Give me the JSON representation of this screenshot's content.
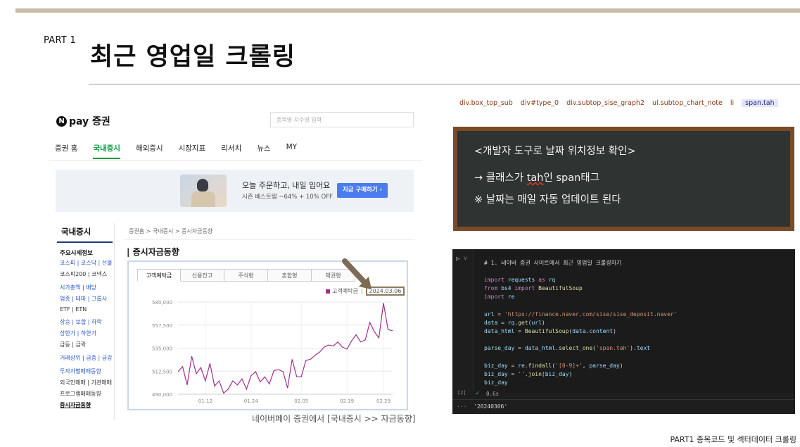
{
  "slide": {
    "part_label": "PART 1",
    "title": "최근 영업일 크롤링",
    "caption": "네이버페이 증권에서 [국내증시 >> 자금동향]",
    "footer": "PART1 종목코드 및 섹터데이터 크롤링"
  },
  "naver": {
    "logo_text": "pay 증권",
    "logo_mark": "N",
    "search_placeholder": "종목명·지수명 입력",
    "gnb": [
      "증권 홈",
      "국내증시",
      "해외증시",
      "시장지표",
      "리서치",
      "뉴스",
      "MY"
    ],
    "gnb_active": "국내증시",
    "banner": {
      "title": "오늘 주문하고, 내일 입어요",
      "sub": "시즌 베스트템 ~64% + 10% OFF",
      "button": "지금 구매하기 ›"
    },
    "sidebar": {
      "title": "국내증시",
      "groups": [
        {
          "head": "주요시세정보",
          "rows": [
            "코스피 | 코스닥 | 선물",
            "코스피200 | 코넥스"
          ],
          "row_style": [
            "blue",
            "plain"
          ]
        },
        {
          "head": "",
          "rows": [
            "시가총액 | 배당",
            "업종 | 테마 | 그룹사",
            "ETF | ETN"
          ],
          "row_style": [
            "blue",
            "blue",
            "plain"
          ]
        },
        {
          "head": "",
          "rows": [
            "상승 | 보합 | 하락",
            "상한가 | 하한가",
            "급등 | 급락"
          ],
          "row_style": [
            "blue",
            "blue",
            "plain"
          ]
        },
        {
          "head": "",
          "rows": [
            "거래상위 | 급증 | 급감"
          ],
          "row_style": [
            "blue"
          ]
        },
        {
          "head": "",
          "rows": [
            "투자자별매매동향",
            "외국인매매 | 기관매매",
            "프로그램매매동향",
            "증시자금동향"
          ],
          "row_style": [
            "blue",
            "plain",
            "plain",
            "sel"
          ]
        }
      ]
    },
    "breadcrumb": "증권홈 > 국내증시 > 증시자금동향",
    "section_title": "증시자금동향",
    "tabs": [
      "고객예탁금",
      "신용잔고",
      "주식형",
      "혼합형",
      "채권형"
    ],
    "tab_active": "고객예탁금",
    "legend_label": "고객예탁금",
    "legend_date": "2024.03.06"
  },
  "chart_data": {
    "type": "line",
    "title": "",
    "xlabel": "",
    "ylabel": "",
    "y_ticks": [
      "580,000",
      "557,500",
      "535,000",
      "512,500",
      "490,000"
    ],
    "x_ticks": [
      "01.12",
      "01.24",
      "02.05",
      "02.19",
      "02.29"
    ],
    "ylim": [
      490000,
      580000
    ],
    "series": [
      {
        "name": "고객예탁금",
        "color": "#a0308a",
        "values": [
          512000,
          517000,
          499000,
          527000,
          510000,
          516000,
          503000,
          520000,
          498000,
          503000,
          491000,
          495000,
          503000,
          499000,
          505000,
          495000,
          508000,
          512000,
          502000,
          507000,
          500000,
          513000,
          514000,
          512000,
          496000,
          524000,
          507000,
          507000,
          523000,
          524000,
          528000,
          531000,
          536000,
          538000,
          537000,
          541000,
          536000,
          534000,
          542000,
          548000,
          541000,
          543000,
          560000,
          551000,
          545000,
          579000,
          553000,
          552000
        ]
      }
    ]
  },
  "devtools_path": [
    "div.box_top_sub",
    "div#type_0",
    "div.subtop_sise_graph2",
    "ul.subtop_chart_note",
    "li",
    "span.tah"
  ],
  "board": {
    "line1": "<개발자 도구로 날짜 위치정보 확인>",
    "line2_pre": "→ 클래스가 ",
    "line2_under": "tah",
    "line2_post": "인 span태그",
    "line3": "※ 날짜는 매일 자동 업데이트 된다"
  },
  "code": {
    "comment": "# 1. 네이버 증권 사이트에서 최근 영업일 크롤링하기",
    "import1": "import requests as rq",
    "import2": "from bs4 import BeautifulSoup",
    "import3": "import re",
    "url_line": "url = 'https://finance.naver.com/sise/sise_deposit.naver'",
    "data_line": "data = rq.get(url)",
    "html_line": "data_html = BeautifulSoup(data.content)",
    "parse_line": "parse_day = data_html.select_one('span.tah').text",
    "biz1": "biz_day = re.findall('[0-9]+', parse_day)",
    "biz2": "biz_day = ''.join(biz_day)",
    "biz3": "biz_day",
    "exec_count": "[2]",
    "exec_time": "0.6s",
    "output": "'20240306'"
  }
}
